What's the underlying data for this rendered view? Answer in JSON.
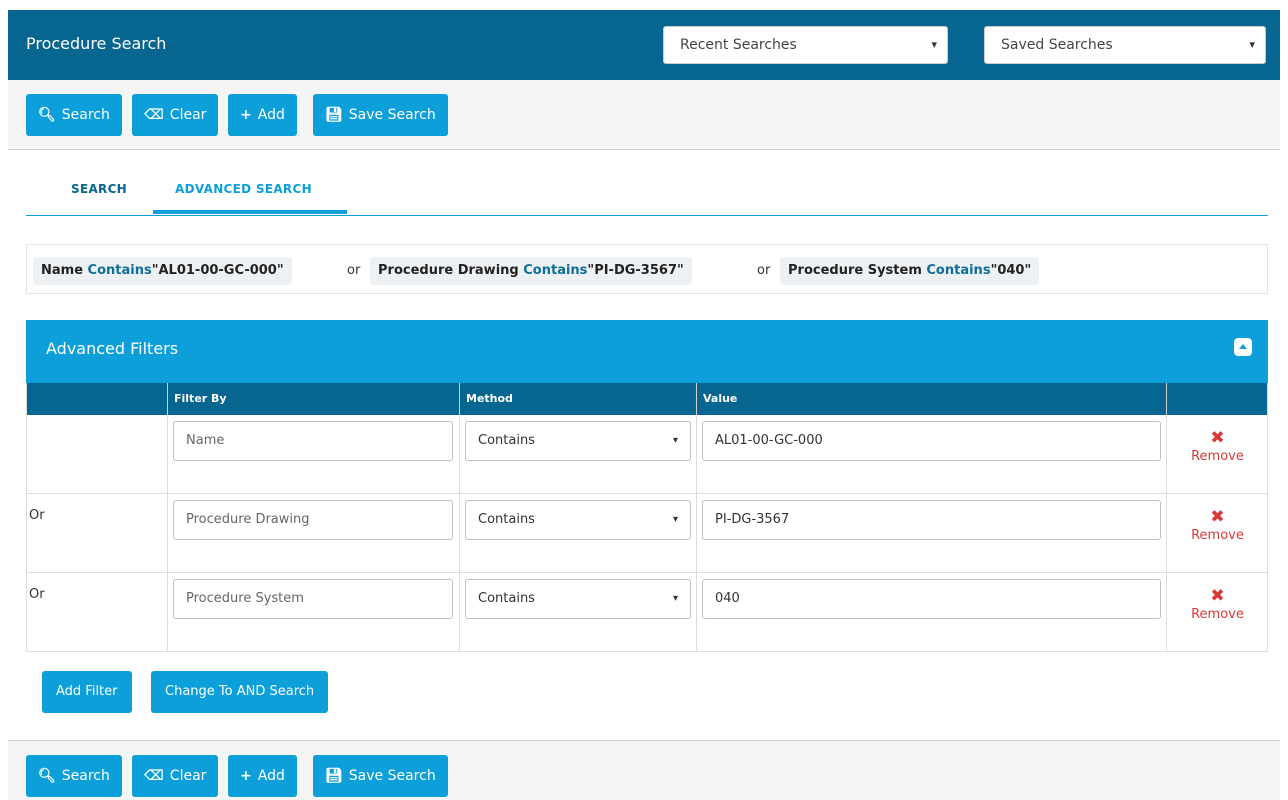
{
  "header": {
    "title": "Procedure Search",
    "recent_searches": "Recent Searches",
    "saved_searches": "Saved Searches"
  },
  "toolbar": {
    "search": "Search",
    "clear": "Clear",
    "add": "Add",
    "save_search": "Save Search"
  },
  "tabs": [
    {
      "label": "SEARCH",
      "active": false
    },
    {
      "label": "ADVANCED SEARCH",
      "active": true
    }
  ],
  "summary": {
    "conjunction": "or",
    "terms": [
      {
        "field": "Name",
        "method": "Contains",
        "value": "\"AL01-00-GC-000\""
      },
      {
        "field": "Procedure Drawing",
        "method": "Contains",
        "value": "\"PI-DG-3567\""
      },
      {
        "field": "Procedure System",
        "method": "Contains",
        "value": "\"040\""
      }
    ]
  },
  "advanced_filters": {
    "title": "Advanced Filters",
    "columns": [
      "",
      "Filter By",
      "Method",
      "Value",
      ""
    ],
    "rows": [
      {
        "conjunction": "",
        "filter_by": "Name",
        "method": "Contains",
        "value": "AL01-00-GC-000",
        "remove": "Remove"
      },
      {
        "conjunction": "Or",
        "filter_by": "Procedure Drawing",
        "method": "Contains",
        "value": "PI-DG-3567",
        "remove": "Remove"
      },
      {
        "conjunction": "Or",
        "filter_by": "Procedure System",
        "method": "Contains",
        "value": "040",
        "remove": "Remove"
      }
    ],
    "add_filter": "Add Filter",
    "change_mode": "Change To AND Search"
  },
  "colors": {
    "header": "#07668f",
    "accent": "#0c9fd9",
    "danger": "#d83939"
  }
}
